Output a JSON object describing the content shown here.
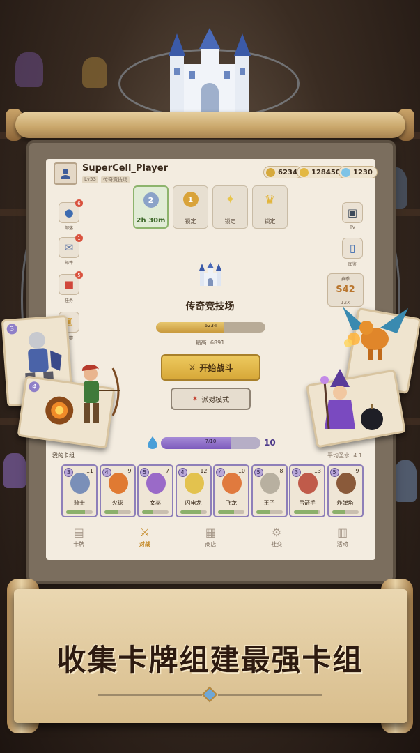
{
  "player": {
    "name": "SuperCell_Player",
    "sub1": "Lv53",
    "sub2": "传奇竞技场"
  },
  "currencies": [
    {
      "value": "6234",
      "color": "#d6a93c",
      "icon": "trophy-coin-icon"
    },
    {
      "value": "128450",
      "color": "#e3b843",
      "icon": "gold-coin-icon"
    },
    {
      "value": "1230",
      "color": "#7ec3e6",
      "icon": "gem-icon"
    }
  ],
  "rewards": [
    {
      "label": "2h 30m",
      "medal": "2",
      "color": "#8ba2c8",
      "icon": "silver-medal-icon",
      "active": true
    },
    {
      "label": "锁定",
      "medal": "1",
      "color": "#d9a33a",
      "icon": "gold-medal-icon"
    },
    {
      "label": "锁定",
      "medal": "✦",
      "color": "#e8c54b",
      "icon": "sparkle-icon"
    },
    {
      "label": "锁定",
      "medal": "♛",
      "color": "#e2b53c",
      "icon": "crown-icon"
    }
  ],
  "left_menu": [
    {
      "label": "部落",
      "badge": "6",
      "icon": "clan-icon"
    },
    {
      "label": "邮件",
      "badge": "1",
      "icon": "mail-icon"
    },
    {
      "label": "任务",
      "badge": "5",
      "icon": "gift-icon"
    },
    {
      "label": "联赛",
      "badge": "",
      "icon": "trophy-icon"
    }
  ],
  "right_menu": [
    {
      "label": "TV",
      "icon": "tv-icon"
    },
    {
      "label": "图鉴",
      "icon": "book-icon"
    }
  ],
  "season": {
    "title": "赛季",
    "value": "S42",
    "mult": "12X"
  },
  "arena": {
    "name": "传奇竞技场",
    "trophies": "6234",
    "trophy_progress": 0.62,
    "best": "最高: 6891"
  },
  "buttons": {
    "battle": "开始战斗",
    "party": "派对模式"
  },
  "elixir": {
    "text": "7/10",
    "value": "10",
    "fraction": 0.7
  },
  "deck": {
    "title": "我的卡组",
    "avg": "平均圣水: 4.1",
    "cards": [
      {
        "name": "骑士",
        "cost": "3",
        "level": "11",
        "color": "#7a8fb8",
        "progress": 0.7
      },
      {
        "name": "火球",
        "cost": "4",
        "level": "9",
        "color": "#e07a32",
        "progress": 0.5
      },
      {
        "name": "女巫",
        "cost": "5",
        "level": "7",
        "color": "#9a6ac8",
        "progress": 0.4
      },
      {
        "name": "闪电龙",
        "cost": "4",
        "level": "12",
        "color": "#e3c24e",
        "progress": 0.8
      },
      {
        "name": "飞龙",
        "cost": "4",
        "level": "10",
        "color": "#e07a3e",
        "progress": 0.6
      },
      {
        "name": "王子",
        "cost": "5",
        "level": "8",
        "color": "#b8b0a0",
        "progress": 0.5
      },
      {
        "name": "弓箭手",
        "cost": "3",
        "level": "13",
        "color": "#c05b4a",
        "progress": 0.9
      },
      {
        "name": "炸弹塔",
        "cost": "5",
        "level": "9",
        "color": "#8a5a3a",
        "progress": 0.5
      }
    ]
  },
  "nav": [
    {
      "label": "卡牌",
      "icon": "cards-icon",
      "glyph": "▤"
    },
    {
      "label": "对战",
      "icon": "swords-icon",
      "glyph": "⚔",
      "active": true
    },
    {
      "label": "商店",
      "icon": "shop-icon",
      "glyph": "▦"
    },
    {
      "label": "社交",
      "icon": "gear-icon",
      "glyph": "⚙"
    },
    {
      "label": "活动",
      "icon": "chart-icon",
      "glyph": "▥"
    }
  ],
  "floating_cards": {
    "left_top": "3",
    "left_bottom": "4"
  },
  "banner": {
    "text": "收集卡牌组建最强卡组"
  }
}
